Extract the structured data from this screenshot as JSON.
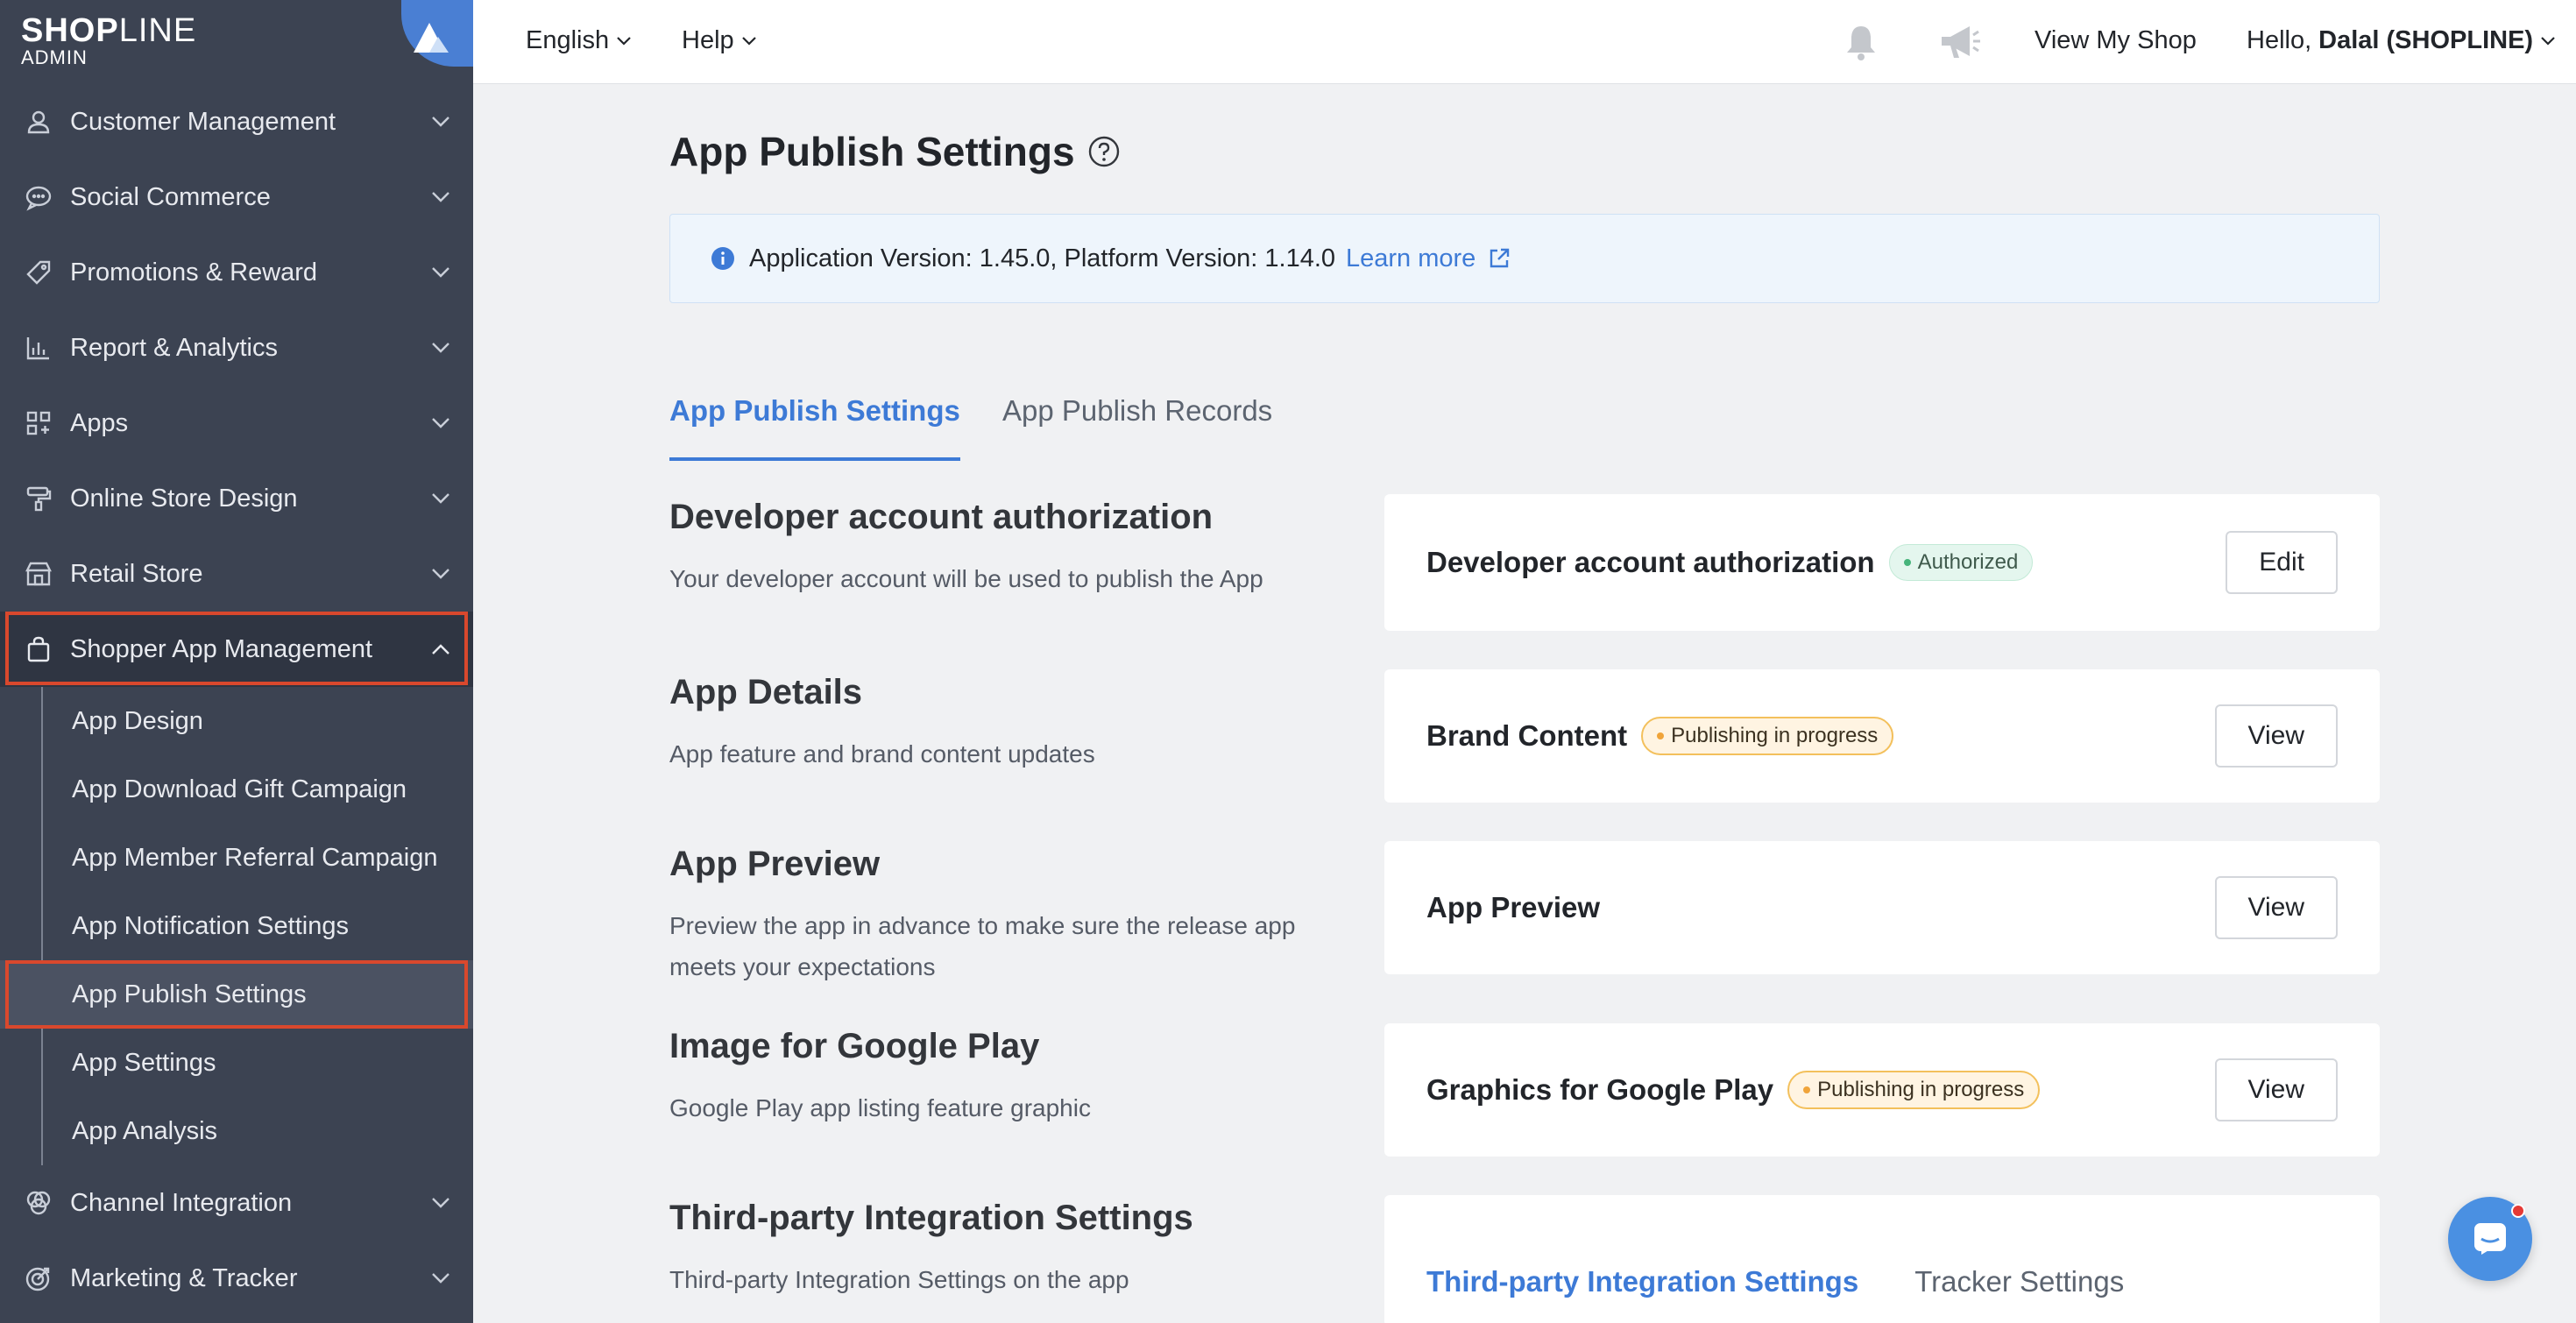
{
  "brand": {
    "logo_bold": "SHOP",
    "logo_thin": "LINE",
    "logo_sub": "ADMIN"
  },
  "sidebar": {
    "items": [
      {
        "label": "Customer Management",
        "icon": "person-icon"
      },
      {
        "label": "Social Commerce",
        "icon": "chat-bubble-icon"
      },
      {
        "label": "Promotions & Reward",
        "icon": "tag-icon"
      },
      {
        "label": "Report & Analytics",
        "icon": "bar-chart-icon"
      },
      {
        "label": "Apps",
        "icon": "apps-grid-icon"
      },
      {
        "label": "Online Store Design",
        "icon": "paint-roller-icon"
      },
      {
        "label": "Retail Store",
        "icon": "store-icon"
      },
      {
        "label": "Shopper App Management",
        "icon": "shopping-bag-icon"
      }
    ],
    "sub_items": [
      {
        "label": "App Design"
      },
      {
        "label": "App Download Gift Campaign"
      },
      {
        "label": "App Member Referral Campaign"
      },
      {
        "label": "App Notification Settings"
      },
      {
        "label": "App Publish Settings"
      },
      {
        "label": "App Settings"
      },
      {
        "label": "App Analysis"
      }
    ],
    "bottom_items": [
      {
        "label": "Channel Integration",
        "icon": "channel-icon"
      },
      {
        "label": "Marketing & Tracker",
        "icon": "target-icon"
      }
    ],
    "highlight_color": "#d9482d"
  },
  "topbar": {
    "language": "English",
    "help": "Help",
    "view_shop": "View My Shop",
    "greeting": "Hello,",
    "user": "Dalal (SHOPLINE)"
  },
  "page": {
    "title": "App Publish Settings",
    "banner_text": "Application Version: 1.45.0, Platform Version: 1.14.0",
    "banner_link": "Learn more",
    "tabs": [
      "App Publish Settings",
      "App Publish Records"
    ],
    "accent_color": "#3d7ad6"
  },
  "sections": [
    {
      "title": "Developer account authorization",
      "desc": "Your developer account will be used to publish the App",
      "card_title": "Developer account authorization",
      "badge": "Authorized",
      "button": "Edit"
    },
    {
      "title": "App Details",
      "desc": "App feature and brand content updates",
      "card_title": "Brand Content",
      "badge": "Publishing in progress",
      "button": "View"
    },
    {
      "title": "App Preview",
      "desc_1": "Preview the app in advance to make sure the release app",
      "desc_2": "meets your expectations",
      "card_title": "App Preview",
      "button": "View"
    },
    {
      "title": "Image for Google Play",
      "desc": "Google Play app listing feature graphic",
      "card_title": "Graphics for Google Play",
      "badge": "Publishing in progress",
      "button": "View"
    },
    {
      "title": "Third-party Integration Settings",
      "desc": "Third-party Integration Settings on the app",
      "card_tabs": [
        "Third-party Integration Settings",
        "Tracker Settings"
      ]
    }
  ]
}
